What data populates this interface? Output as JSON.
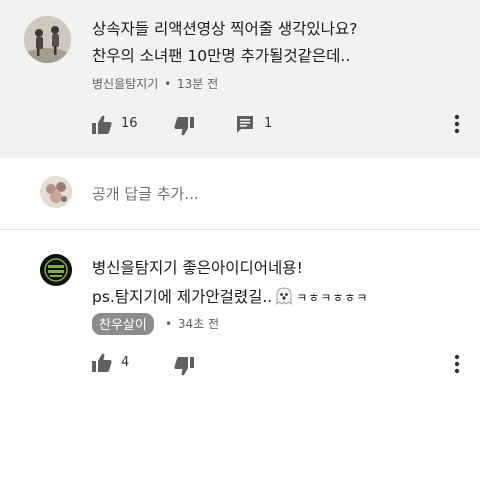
{
  "comment1": {
    "line1": "상속자들 리액션영상 찍어줄 생각있나요?",
    "line2": "찬우의 소녀팬 10만명 추가될것같은데..",
    "author": "병신을탐지기",
    "separator": "•",
    "time": "13분 전",
    "like_count": "16",
    "reply_count": "1"
  },
  "reply_box": {
    "placeholder": "공개 답글 추가..."
  },
  "comment2": {
    "line1": "병신을탐지기 좋은아이디어네용!",
    "line2_text": "ps.탐지기에 제가안걸렸길..",
    "line2_suffix": "ㅋㅎㅋㅎㅎㅋ",
    "author_chip": "찬우살이",
    "separator": "•",
    "time": "34초 전",
    "like_count": "4"
  },
  "colors": {
    "top_background": "#f2f2f2",
    "icon": "#5f5f5f",
    "chip": "#8c8c8c"
  }
}
